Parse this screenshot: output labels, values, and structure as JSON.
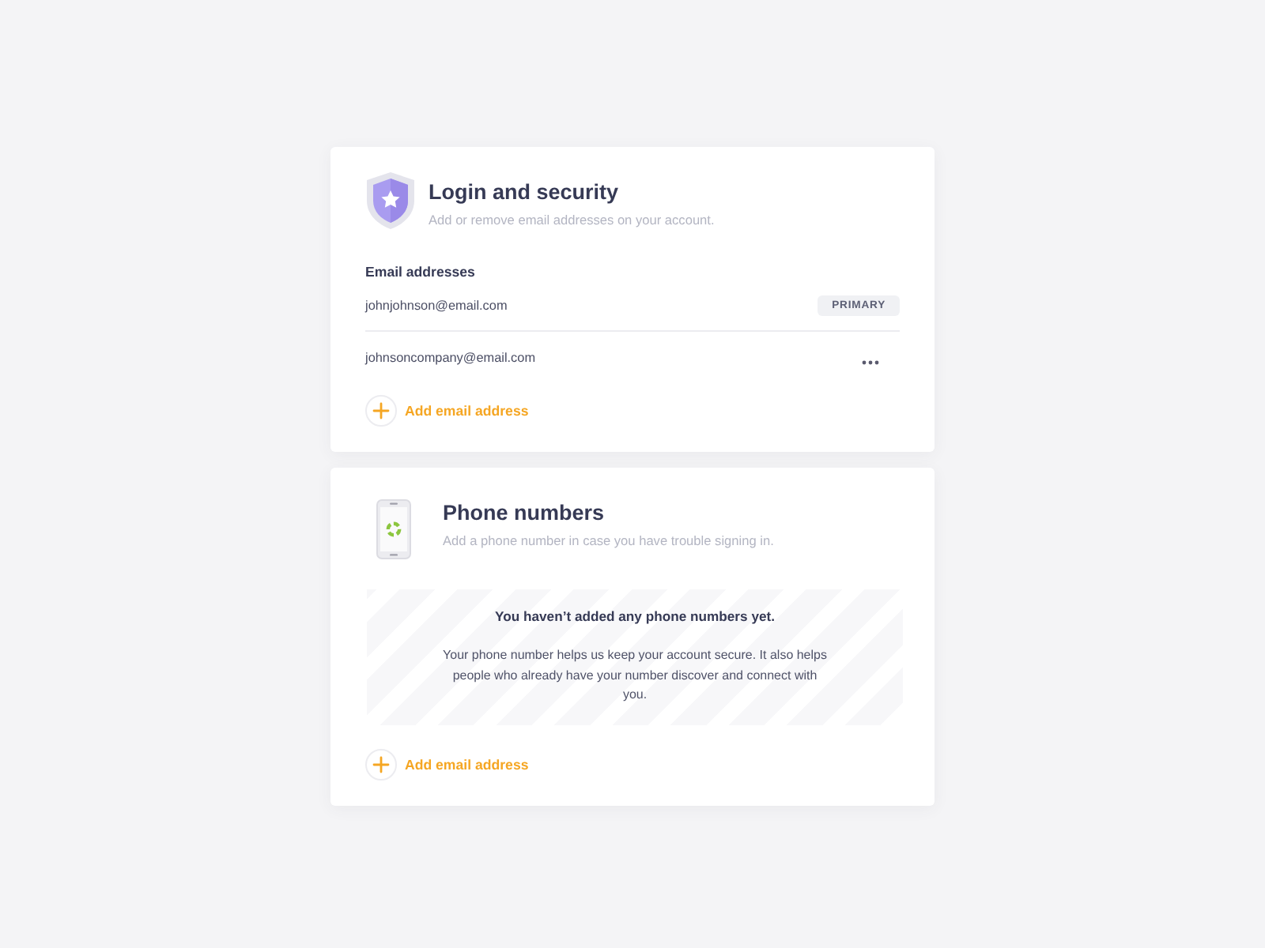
{
  "sections": [
    {
      "kind": "email",
      "title": "Login and security",
      "subtitle": "Add or remove email addresses on your account.",
      "list_label": "Email addresses",
      "emails": [
        {
          "address": "johnjohnson@email.com",
          "badge": "PRIMARY"
        },
        {
          "address": "johnsoncompany@email.com"
        }
      ],
      "add_button": "Add email address"
    },
    {
      "kind": "phone",
      "title": "Phone numbers",
      "subtitle": "Add a phone number in case you have trouble signing in.",
      "empty_state": {
        "heading": "You haven’t added any phone numbers yet.",
        "text": "Your phone number helps us keep your account secure. It also helps people who already have your number discover and connect with you."
      },
      "add_button": "Add email address"
    }
  ]
}
